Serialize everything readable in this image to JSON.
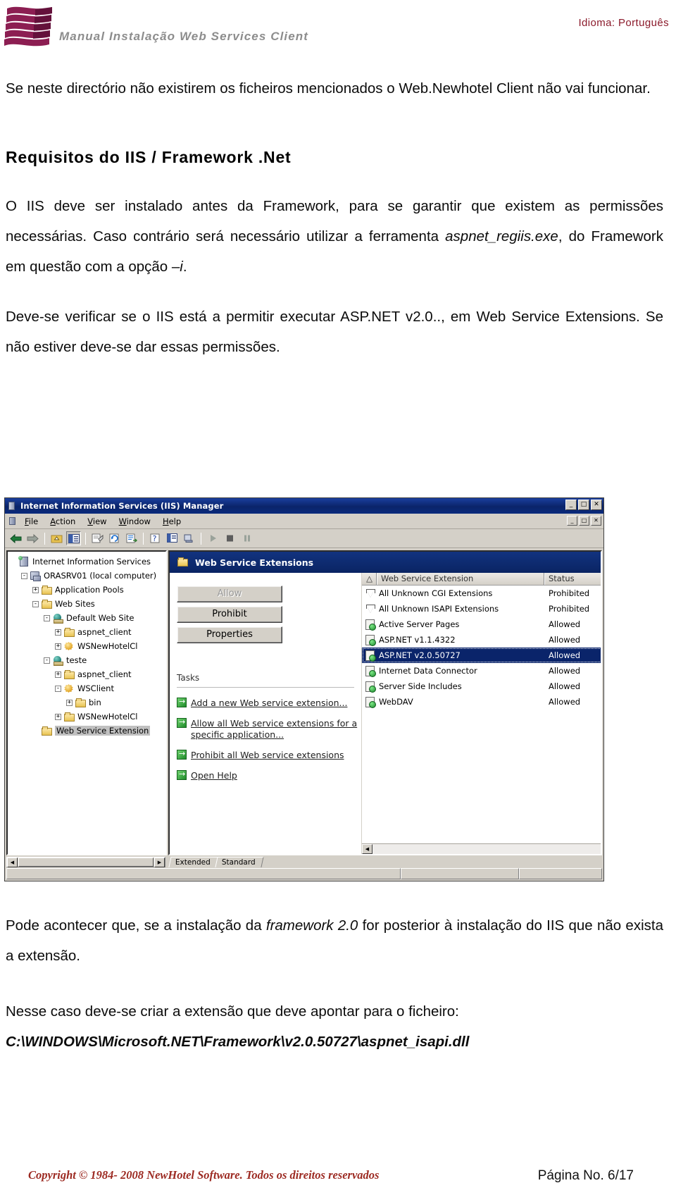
{
  "header": {
    "doc_title": "Manual Instalação Web Services Client",
    "language_label": "Idioma: Português",
    "logo_name": "newhotel-wave-logo"
  },
  "content": {
    "intro_paragraph": "Se neste directório não existirem os ficheiros mencionados o Web.Newhotel Client não vai funcionar.",
    "section_heading": "Requisitos do IIS / Framework .Net",
    "para_framework_part1": "O IIS deve ser instalado antes da Framework, para se garantir que existem as permissões necessárias. Caso contrário será necessário utilizar a ferramenta ",
    "para_framework_italic": "aspnet_regiis.exe",
    "para_framework_part2": ", do Framework em questão com a opção –",
    "para_framework_italic2": "i",
    "para_framework_part3": ".",
    "para_verify": "Deve-se verificar se o IIS está a permitir executar ASP.NET v2.0.., em Web Service Extensions. Se não estiver deve-se dar essas permissões.",
    "para_after_part1": "Pode acontecer que, se a instalação da ",
    "para_after_italic": "framework 2.0",
    "para_after_part2": " for posterior à instalação do IIS que não exista a extensão.",
    "para_create": "Nesse caso deve-se criar a extensão que deve apontar para o ficheiro:",
    "file_path": "C:\\WINDOWS\\Microsoft.NET\\Framework\\v2.0.50727\\aspnet_isapi.dll"
  },
  "iis_window": {
    "title": "Internet Information Services (IIS) Manager",
    "title_icon": "server-icon",
    "window_buttons": [
      "_",
      "□",
      "✕"
    ],
    "mdi_buttons": [
      "_",
      "□",
      "✕"
    ],
    "menu": [
      {
        "label": "File",
        "accel": "F"
      },
      {
        "label": "Action",
        "accel": "A"
      },
      {
        "label": "View",
        "accel": "V"
      },
      {
        "label": "Window",
        "accel": "W"
      },
      {
        "label": "Help",
        "accel": "H"
      }
    ],
    "toolbar_icons": [
      "back-arrow-icon",
      "forward-arrow-icon",
      "up-folder-icon",
      "show-hide-tree-icon",
      "properties-icon",
      "refresh-icon",
      "export-list-icon",
      "help-icon",
      "new-window-icon",
      "disconnect-icon",
      "play-icon",
      "stop-icon",
      "pause-icon"
    ],
    "tree": [
      {
        "label": "Internet Information Services",
        "level": 0,
        "expander": "",
        "icon": "iis-root-icon"
      },
      {
        "label": "ORASRV01 (local computer)",
        "level": 1,
        "expander": "-",
        "icon": "computer-icon"
      },
      {
        "label": "Application Pools",
        "level": 2,
        "expander": "+",
        "icon": "folder-icon"
      },
      {
        "label": "Web Sites",
        "level": 2,
        "expander": "-",
        "icon": "folder-icon"
      },
      {
        "label": "Default Web Site",
        "level": 3,
        "expander": "-",
        "icon": "website-globe-icon"
      },
      {
        "label": "aspnet_client",
        "level": 4,
        "expander": "+",
        "icon": "folder-icon"
      },
      {
        "label": "WSNewHotelCl",
        "level": 4,
        "expander": "+",
        "icon": "application-icon"
      },
      {
        "label": "teste",
        "level": 3,
        "expander": "-",
        "icon": "website-globe-icon"
      },
      {
        "label": "aspnet_client",
        "level": 4,
        "expander": "+",
        "icon": "folder-icon"
      },
      {
        "label": "WSClient",
        "level": 4,
        "expander": "-",
        "icon": "application-icon"
      },
      {
        "label": "bin",
        "level": 5,
        "expander": "+",
        "icon": "folder-icon"
      },
      {
        "label": "WSNewHotelCl",
        "level": 4,
        "expander": "+",
        "icon": "folder-icon"
      },
      {
        "label": "Web Service Extension",
        "level": 2,
        "expander": "",
        "icon": "folder-icon",
        "selected": true
      }
    ],
    "right_panel": {
      "header_title": "Web Service Extensions",
      "header_icon": "folder-icon",
      "buttons": [
        {
          "label": "Allow",
          "disabled": true
        },
        {
          "label": "Prohibit",
          "disabled": false
        },
        {
          "label": "Properties",
          "disabled": false
        }
      ],
      "tasks_label": "Tasks",
      "task_links": [
        "Add a new Web service extension...",
        "Allow all Web service extensions for a specific application...",
        "Prohibit all Web service extensions",
        "Open Help"
      ],
      "list_columns": [
        "",
        "Web Service Extension",
        "Status"
      ],
      "list_rows": [
        {
          "name": "All Unknown CGI Extensions",
          "status": "Prohibited",
          "icon": "filter-icon",
          "selected": false
        },
        {
          "name": "All Unknown ISAPI Extensions",
          "status": "Prohibited",
          "icon": "filter-icon",
          "selected": false
        },
        {
          "name": "Active Server Pages",
          "status": "Allowed",
          "icon": "page-allowed-icon",
          "selected": false
        },
        {
          "name": "ASP.NET v1.1.4322",
          "status": "Allowed",
          "icon": "page-allowed-icon",
          "selected": false
        },
        {
          "name": "ASP.NET v2.0.50727",
          "status": "Allowed",
          "icon": "page-allowed-icon",
          "selected": true
        },
        {
          "name": "Internet Data Connector",
          "status": "Allowed",
          "icon": "page-allowed-icon",
          "selected": false
        },
        {
          "name": "Server Side Includes",
          "status": "Allowed",
          "icon": "page-allowed-icon",
          "selected": false
        },
        {
          "name": "WebDAV",
          "status": "Allowed",
          "icon": "page-allowed-icon",
          "selected": false
        }
      ],
      "tabs": [
        "Extended",
        "Standard"
      ]
    }
  },
  "footer": {
    "copyright": "Copyright © 1984- 2008 NewHotel Software. Todos os direitos reservados",
    "page": "Página No. 6/17"
  },
  "colors": {
    "brand_magenta": "#8c1e52",
    "header_gray": "#8d8d8d",
    "lang_red": "#8b1a2b",
    "footer_red": "#9c2a22",
    "titlebar_blue": "#0a246a",
    "selection_blue": "#0a246a"
  }
}
